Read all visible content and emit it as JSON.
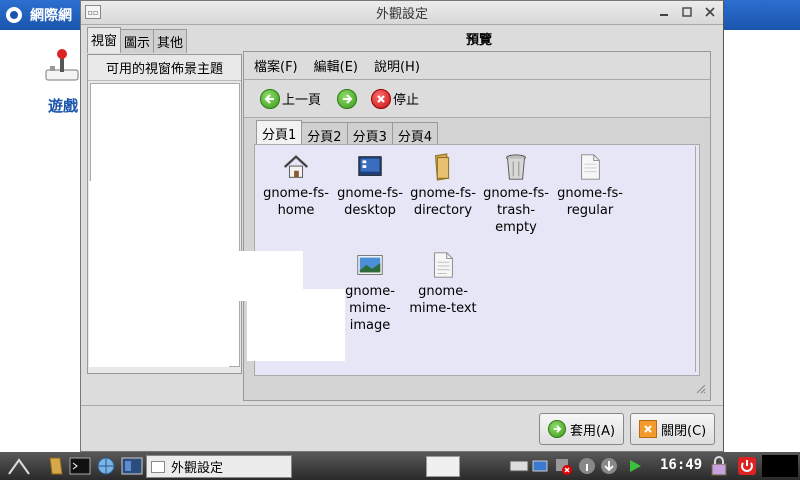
{
  "background_app": {
    "title": "網際網",
    "label": "遊戲"
  },
  "dialog": {
    "title": "外觀設定",
    "left_tabs": [
      {
        "label": "視窗"
      },
      {
        "label": "圖示"
      },
      {
        "label": "其他"
      }
    ],
    "left_header": "可用的視窗佈景主題",
    "preview_label": "預覽",
    "menu": [
      {
        "label": "檔案(F)"
      },
      {
        "label": "編輯(E)"
      },
      {
        "label": "說明(H)"
      }
    ],
    "toolbar": {
      "back_label": "上一頁",
      "stop_label": "停止"
    },
    "page_tabs": [
      {
        "label": "分頁1"
      },
      {
        "label": "分頁2"
      },
      {
        "label": "分頁3"
      },
      {
        "label": "分頁4"
      }
    ],
    "icons": [
      {
        "label": "gnome-fs-home",
        "icon": "home-icon"
      },
      {
        "label": "gnome-fs-desktop",
        "icon": "desktop-icon"
      },
      {
        "label": "gnome-fs-directory",
        "icon": "folder-icon"
      },
      {
        "label": "gnome-fs-trash-empty",
        "icon": "trash-icon"
      },
      {
        "label": "gnome-fs-regular",
        "icon": "document-icon"
      },
      {
        "label": "gnome-mime-image",
        "icon": "image-icon"
      },
      {
        "label": "gnome-mime-text",
        "icon": "text-file-icon"
      }
    ],
    "apply_label": "套用(A)",
    "close_label": "關閉(C)"
  },
  "taskbar": {
    "task_title": "外觀設定",
    "clock": "16:49"
  }
}
